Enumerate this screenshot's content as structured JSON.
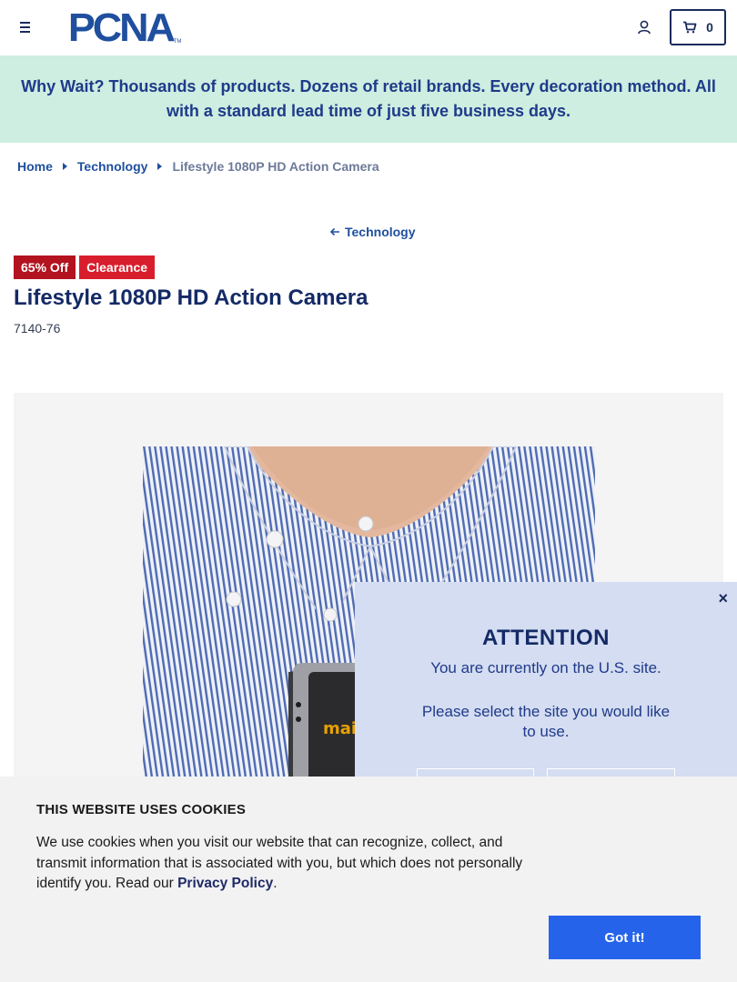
{
  "header": {
    "logo_text": "PCNA",
    "logo_tm": "TM",
    "cart_count": "0"
  },
  "promo": {
    "text": "Why Wait? Thousands of products. Dozens of retail brands. Every decoration method. All with a standard lead time of just five business days."
  },
  "breadcrumb": {
    "items": [
      {
        "label": "Home"
      },
      {
        "label": "Technology"
      },
      {
        "label": "Lifestyle 1080P HD Action Camera"
      }
    ]
  },
  "back_link": "Technology",
  "product": {
    "badges": [
      "65% Off",
      "Clearance"
    ],
    "title": "Lifestyle 1080P HD Action Camera",
    "sku": "7140-76",
    "camera_brand_text": "mai"
  },
  "attention": {
    "close": "×",
    "title": "ATTENTION",
    "message": "You are currently on the U.S. site.",
    "message2": "Please select the site you would like to use."
  },
  "cookie": {
    "title": "THIS WEBSITE USES COOKIES",
    "text_before": "We use cookies when you visit our website that can recognize, collect, and transmit information that is associated with you, but which does not personally identify you. Read our ",
    "link": "Privacy Policy",
    "text_after": ".",
    "button": "Got it!"
  },
  "colors": {
    "brand_navy": "#1a2a5c",
    "brand_blue": "#1f4f9e",
    "promo_bg": "#cdeee0",
    "badge_red_dark": "#b3121f",
    "badge_red": "#d81e2c",
    "modal_bg": "#d4ddf1",
    "cookie_button": "#2563eb"
  }
}
